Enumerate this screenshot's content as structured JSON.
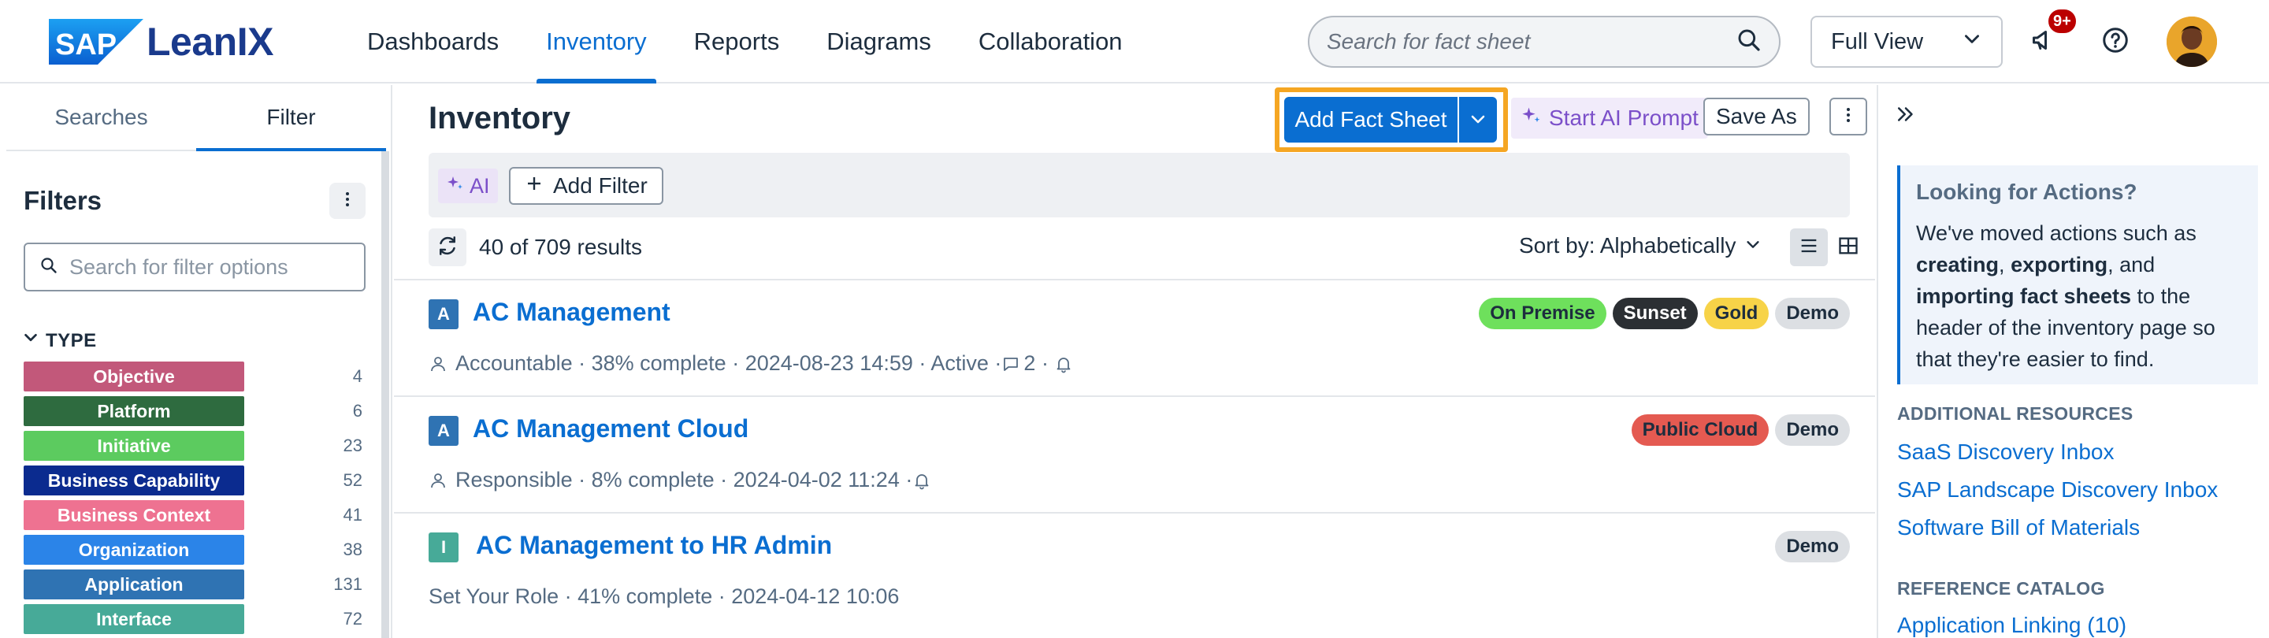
{
  "app": {
    "logo_sap": "SAP",
    "logo_product": "LeanIX"
  },
  "nav": [
    {
      "label": "Dashboards",
      "active": false
    },
    {
      "label": "Inventory",
      "active": true
    },
    {
      "label": "Reports",
      "active": false
    },
    {
      "label": "Diagrams",
      "active": false
    },
    {
      "label": "Collaboration",
      "active": false
    }
  ],
  "header": {
    "search_placeholder": "Search for fact sheet",
    "view_select": "Full View",
    "notifications_badge": "9+"
  },
  "sidebar": {
    "tabs": [
      "Searches",
      "Filter"
    ],
    "active_tab": "Filter",
    "title": "Filters",
    "search_placeholder": "Search for filter options",
    "type_heading": "TYPE",
    "types": [
      {
        "label": "Objective",
        "count": "4",
        "color": "#c2587a"
      },
      {
        "label": "Platform",
        "count": "6",
        "color": "#2e6b3f"
      },
      {
        "label": "Initiative",
        "count": "23",
        "color": "#5ccb5f"
      },
      {
        "label": "Business Capability",
        "count": "52",
        "color": "#0b2b8f"
      },
      {
        "label": "Business Context",
        "count": "41",
        "color": "#ee7291"
      },
      {
        "label": "Organization",
        "count": "38",
        "color": "#2b84e8"
      },
      {
        "label": "Application",
        "count": "131",
        "color": "#2f73b3"
      },
      {
        "label": "Interface",
        "count": "72",
        "color": "#47aa98"
      }
    ]
  },
  "main": {
    "title": "Inventory",
    "add_button": "Add Fact Sheet",
    "ai_prompt": "Start AI Prompt",
    "save_as": "Save As",
    "ai_chip": "AI",
    "add_filter": "Add Filter",
    "results": "40 of 709 results",
    "sort": "Sort by: Alphabetically"
  },
  "rows": [
    {
      "icon_letter": "A",
      "icon_color": "#2f73b3",
      "title": "AC Management",
      "meta": "Accountable · 38% complete · 2024-08-23 14:59 · Active · ",
      "comments": "2",
      "tags": [
        {
          "label": "On Premise",
          "bg": "#6ee05c",
          "fg": "#1d2d3e"
        },
        {
          "label": "Sunset",
          "bg": "#2b2f33",
          "fg": "#ffffff"
        },
        {
          "label": "Gold",
          "bg": "#f7d348",
          "fg": "#1d2d3e"
        },
        {
          "label": "Demo",
          "bg": "#dcdfe3",
          "fg": "#1d2d3e"
        }
      ]
    },
    {
      "icon_letter": "A",
      "icon_color": "#2f73b3",
      "title": "AC Management Cloud",
      "meta": "Responsible · 8% complete · 2024-04-02 11:24 · ",
      "tags": [
        {
          "label": "Public Cloud",
          "bg": "#e45a51",
          "fg": "#1d2d3e"
        },
        {
          "label": "Demo",
          "bg": "#dcdfe3",
          "fg": "#1d2d3e"
        }
      ]
    },
    {
      "icon_letter": "I",
      "icon_color": "#47aa98",
      "title": "AC Management to HR Admin",
      "meta": "Set Your Role · 41% complete · 2024-04-12 10:06",
      "tags": [
        {
          "label": "Demo",
          "bg": "#dcdfe3",
          "fg": "#1d2d3e"
        }
      ]
    }
  ],
  "right_panel": {
    "info_title": "Looking for Actions?",
    "info_text_1": "We've moved actions such as ",
    "info_bold_1": "creating",
    "info_sep_1": ", ",
    "info_bold_2": "exporting",
    "info_sep_2": ", and ",
    "info_bold_3": "importing fact sheets",
    "info_text_2": " to the header of the inventory page so that they're easier to find.",
    "resources_heading": "ADDITIONAL RESOURCES",
    "resources": [
      "SaaS Discovery Inbox",
      "SAP Landscape Discovery Inbox",
      "Software Bill of Materials"
    ],
    "catalog_heading": "REFERENCE CATALOG",
    "catalog_links": [
      "Application Linking (10)"
    ]
  }
}
